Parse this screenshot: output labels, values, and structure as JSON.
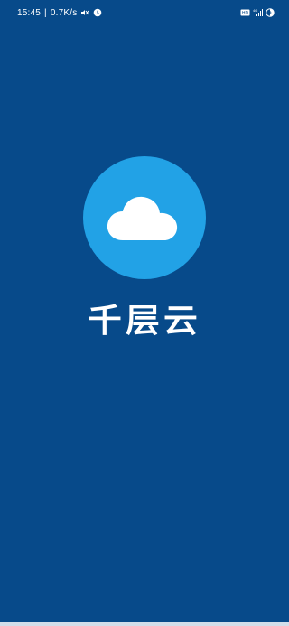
{
  "status_bar": {
    "time": "15:45",
    "network_speed": "0.7K/s",
    "left_icons": [
      "mute-icon",
      "alarm-icon"
    ],
    "right_icons": [
      "hd-icon",
      "signal-4g-icon",
      "battery-icon"
    ]
  },
  "splash": {
    "logo_icon": "cloud-icon",
    "app_name": "千层云"
  },
  "colors": {
    "background": "#074a8a",
    "logo_circle": "#22a2e6",
    "text": "#ffffff"
  }
}
